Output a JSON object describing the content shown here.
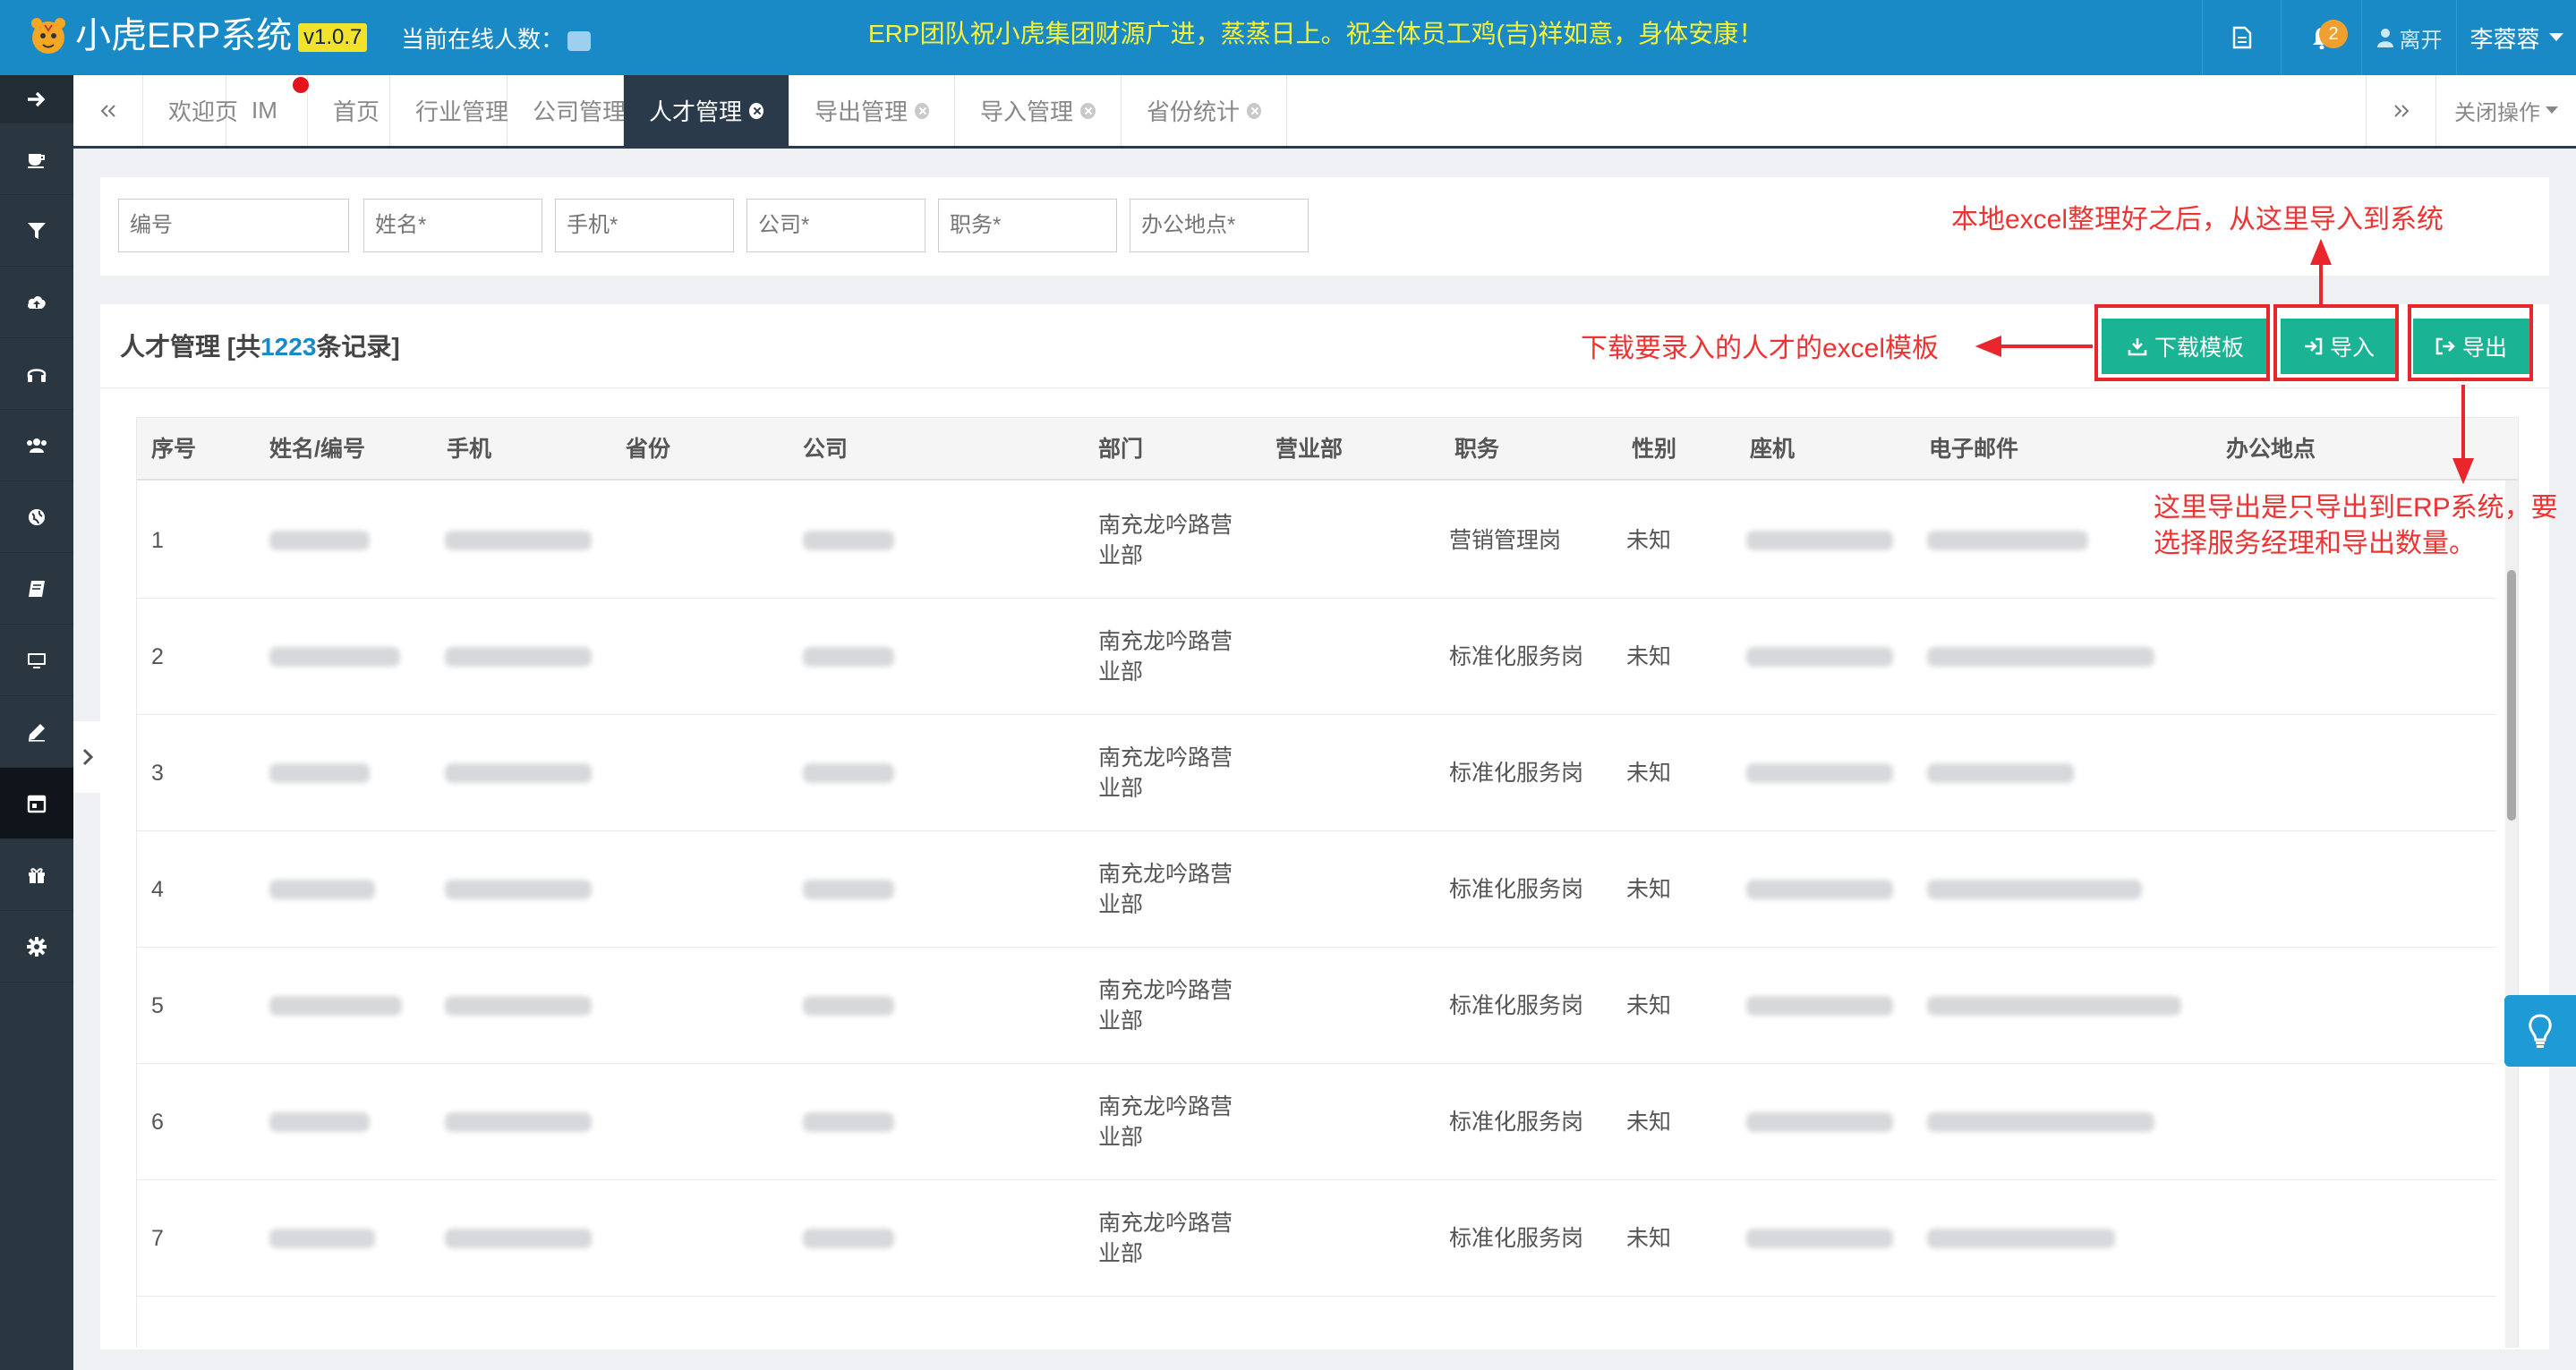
{
  "header": {
    "app_name": "小虎ERP系统",
    "version": "v1.0.7",
    "online_label": "当前在线人数：",
    "slogan": "ERP团队祝小虎集团财源广进，蒸蒸日上。祝全体员工鸡(吉)祥如意，身体安康！",
    "notification_count": "2",
    "logout_label": "离开",
    "user_name": "李蓉蓉"
  },
  "tabs": {
    "items": [
      {
        "label": "欢迎页"
      },
      {
        "label": "IM"
      },
      {
        "label": "首页"
      },
      {
        "label": "行业管理"
      },
      {
        "label": "公司管理"
      },
      {
        "label": "人才管理"
      },
      {
        "label": "导出管理"
      },
      {
        "label": "导入管理"
      },
      {
        "label": "省份统计"
      }
    ],
    "active": "人才管理",
    "close_ops_label": "关闭操作"
  },
  "search": {
    "placeholders": [
      "编号",
      "姓名*",
      "手机*",
      "公司*",
      "职务*",
      "办公地点*"
    ]
  },
  "panel": {
    "title_prefix": "人才管理 [共",
    "record_count": "1223",
    "title_suffix": "条记录]",
    "buttons": {
      "download_template": "下载模板",
      "import": "导入",
      "export": "导出"
    }
  },
  "annotations": {
    "download": "下载要录入的人才的excel模板",
    "import": "本地excel整理好之后，从这里导入到系统",
    "export_line1": "这里导出是只导出到ERP系统，要",
    "export_line2": "选择服务经理和导出数量。"
  },
  "table": {
    "columns": [
      "序号",
      "姓名/编号",
      "手机",
      "省份",
      "公司",
      "部门",
      "营业部",
      "职务",
      "性别",
      "座机",
      "电子邮件",
      "办公地点"
    ],
    "rows": [
      {
        "no": "1",
        "dept_line1": "南充龙吟路营",
        "dept_line2": "业部",
        "position": "营销管理岗",
        "gender": "未知"
      },
      {
        "no": "2",
        "dept_line1": "南充龙吟路营",
        "dept_line2": "业部",
        "position": "标准化服务岗",
        "gender": "未知"
      },
      {
        "no": "3",
        "dept_line1": "南充龙吟路营",
        "dept_line2": "业部",
        "position": "标准化服务岗",
        "gender": "未知"
      },
      {
        "no": "4",
        "dept_line1": "南充龙吟路营",
        "dept_line2": "业部",
        "position": "标准化服务岗",
        "gender": "未知"
      },
      {
        "no": "5",
        "dept_line1": "南充龙吟路营",
        "dept_line2": "业部",
        "position": "标准化服务岗",
        "gender": "未知"
      },
      {
        "no": "6",
        "dept_line1": "南充龙吟路营",
        "dept_line2": "业部",
        "position": "标准化服务岗",
        "gender": "未知"
      },
      {
        "no": "7",
        "dept_line1": "南充龙吟路营",
        "dept_line2": "业部",
        "position": "标准化服务岗",
        "gender": "未知"
      }
    ]
  },
  "colors": {
    "topbar": "#1a8ac6",
    "accent_green": "#1ab394",
    "annotation_red": "#e8262c",
    "sidebar": "#2a3640"
  }
}
